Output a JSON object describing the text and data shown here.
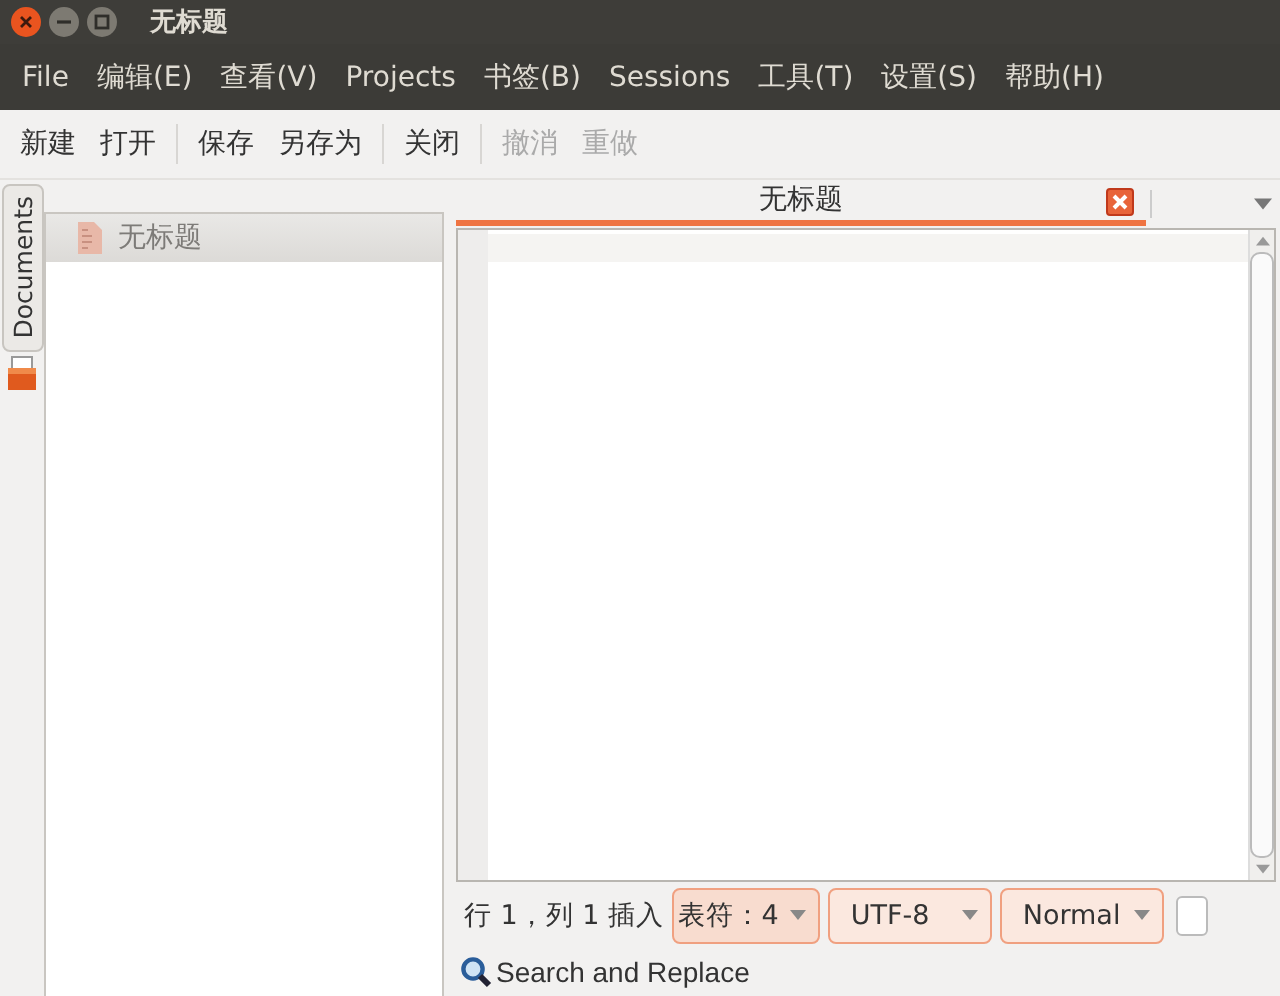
{
  "window": {
    "title": "无标题"
  },
  "menu": [
    "File",
    "编辑(E)",
    "查看(V)",
    "Projects",
    "书签(B)",
    "Sessions",
    "工具(T)",
    "设置(S)",
    "帮助(H)"
  ],
  "toolbar": [
    [
      {
        "label": "新建",
        "disabled": false
      },
      {
        "label": "打开",
        "disabled": false
      }
    ],
    [
      {
        "label": "保存",
        "disabled": false
      },
      {
        "label": "另存为",
        "disabled": false
      }
    ],
    [
      {
        "label": "关闭",
        "disabled": false
      }
    ],
    [
      {
        "label": "撤消",
        "disabled": true
      },
      {
        "label": "重做",
        "disabled": true
      }
    ]
  ],
  "side_tab": {
    "label": "Documents"
  },
  "documents": [
    {
      "name": "无标题",
      "selected": true
    }
  ],
  "editor_tabs": [
    {
      "title": "无标题",
      "selected": true
    }
  ],
  "status": {
    "position": "行 1，列 1",
    "mode": "插入",
    "tab_width": "表符：4",
    "encoding": "UTF-8",
    "highlight": "Normal"
  },
  "search_bar": {
    "label": "Search and Replace"
  }
}
